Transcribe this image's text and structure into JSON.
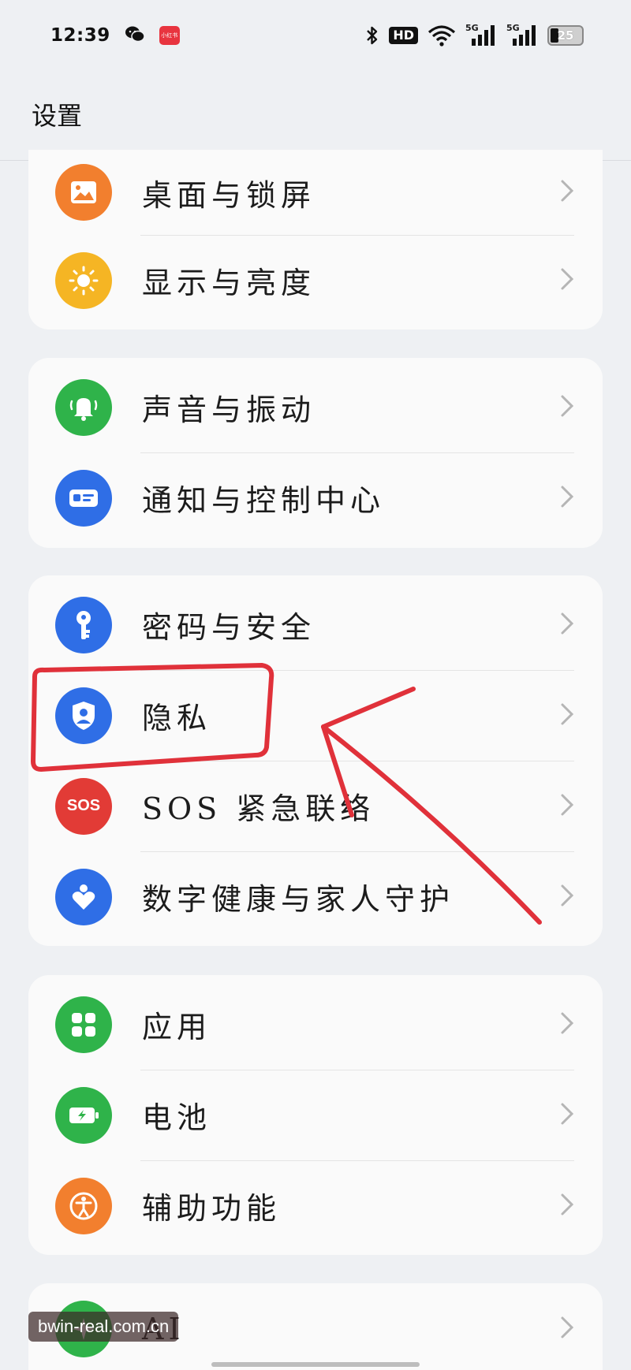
{
  "status": {
    "time": "12:39",
    "hd": "HD",
    "battery": "25",
    "signal_1": "5G",
    "signal_2": "5G",
    "app_badge_text": "小红书"
  },
  "header": {
    "title": "设置"
  },
  "groups": [
    {
      "items": [
        {
          "label": "桌面与锁屏",
          "icon": "wallpaper-icon",
          "color": "#f27f2e"
        },
        {
          "label": "显示与亮度",
          "icon": "sun-icon",
          "color": "#f5b524"
        }
      ]
    },
    {
      "items": [
        {
          "label": "声音与振动",
          "icon": "bell-icon",
          "color": "#2fb34a"
        },
        {
          "label": "通知与控制中心",
          "icon": "notification-icon",
          "color": "#2f6ee6"
        }
      ]
    },
    {
      "items": [
        {
          "label": "密码与安全",
          "icon": "key-icon",
          "color": "#2f6ee6"
        },
        {
          "label": "隐私",
          "icon": "privacy-shield-icon",
          "color": "#2f6ee6"
        },
        {
          "label": "SOS 紧急联络",
          "icon": "sos-icon",
          "color": "#e23b36",
          "icon_text": "SOS"
        },
        {
          "label": "数字健康与家人守护",
          "icon": "heart-icon",
          "color": "#2f6ee6"
        }
      ]
    },
    {
      "items": [
        {
          "label": "应用",
          "icon": "apps-grid-icon",
          "color": "#2fb34a"
        },
        {
          "label": "电池",
          "icon": "battery-icon",
          "color": "#2fb34a"
        },
        {
          "label": "辅助功能",
          "icon": "accessibility-icon",
          "color": "#f27f2e"
        }
      ]
    },
    {
      "items": [
        {
          "label": "AI",
          "icon": "ai-icon",
          "color": "#2fb34a"
        }
      ]
    }
  ],
  "watermark": "bwin-real.com.cn",
  "colors": {
    "annotation_red": "#e0313a",
    "background": "#eef0f3",
    "card": "#fafafa"
  }
}
